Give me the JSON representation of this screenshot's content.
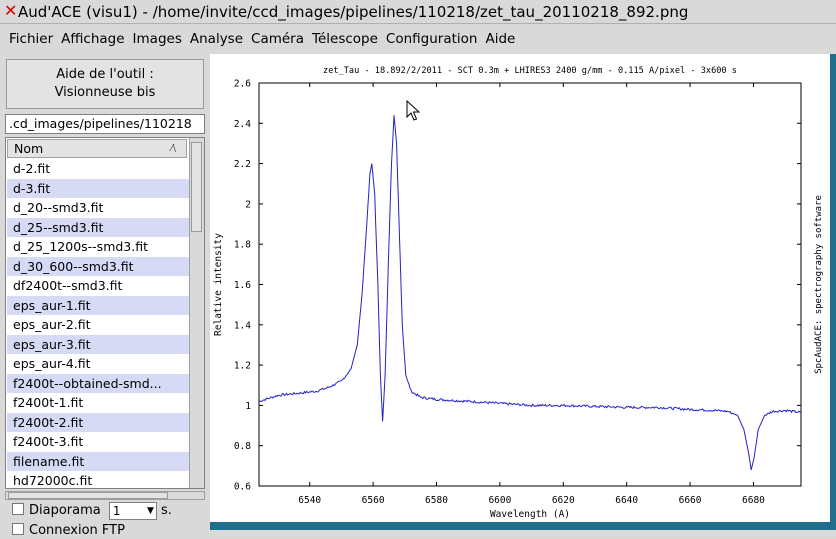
{
  "window": {
    "title": "Aud'ACE (visu1) - /home/invite/ccd_images/pipelines/110218/zet_tau_20110218_892.png"
  },
  "menu": [
    "Fichier",
    "Affichage",
    "Images",
    "Analyse",
    "Caméra",
    "Télescope",
    "Configuration",
    "Aide"
  ],
  "sidebar": {
    "help_line1": "Aide de l'outil :",
    "help_line2": "Visionneuse bis",
    "path": ".cd_images/pipelines/110218",
    "column_header": "Nom",
    "files": [
      "d-2.fit",
      "d-3.fit",
      "d_20--smd3.fit",
      "d_25--smd3.fit",
      "d_25_1200s--smd3.fit",
      "d_30_600--smd3.fit",
      "df2400t--smd3.fit",
      "eps_aur-1.fit",
      "eps_aur-2.fit",
      "eps_aur-3.fit",
      "eps_aur-4.fit",
      "f2400t--obtained-smd...",
      "f2400t-1.fit",
      "f2400t-2.fit",
      "f2400t-3.fit",
      "filename.fit",
      "hd72000c.fit"
    ],
    "diaporama_label": "Diaporama",
    "diaporama_value": "1",
    "diaporama_unit": "s.",
    "ftp_label": "Connexion FTP"
  },
  "colors": {
    "spectrum": "#2222cc",
    "accent": "#1f6f8b"
  },
  "chart_data": {
    "type": "line",
    "title": "zet_Tau - 18.892/2/2011 - SCT 0.3m + LHIRES3 2400 g/mm - 0.115 A/pixel - 3x600 s",
    "xlabel": "Wavelength (A)",
    "ylabel": "Relative intensity",
    "right_label": "SpcAudACE: spectrography software",
    "xlim": [
      6524,
      6695
    ],
    "ylim": [
      0.6,
      2.6
    ],
    "xticks": [
      6540,
      6560,
      6580,
      6600,
      6620,
      6640,
      6660,
      6680
    ],
    "yticks": [
      0.6,
      0.8,
      1,
      1.2,
      1.4,
      1.6,
      1.8,
      2,
      2.2,
      2.4,
      2.6
    ],
    "grid": false,
    "series": [
      {
        "x": [
          6524,
          6530,
          6536,
          6542,
          6546,
          6550,
          6553,
          6555,
          6556.5,
          6558,
          6559,
          6559.6,
          6560.5,
          6561.5,
          6562.3,
          6563,
          6563.8,
          6564.8,
          6565.8,
          6566.6,
          6567.4,
          6568.3,
          6569.2,
          6570.3,
          6572,
          6575,
          6580,
          6590,
          6600,
          6610,
          6620,
          6630,
          6640,
          6650,
          6660,
          6668,
          6672,
          6675,
          6677,
          6678.5,
          6679.3,
          6680.2,
          6681.5,
          6683.5,
          6686,
          6690,
          6695
        ],
        "y": [
          1.02,
          1.05,
          1.06,
          1.07,
          1.09,
          1.12,
          1.18,
          1.3,
          1.55,
          1.9,
          2.15,
          2.2,
          2.05,
          1.6,
          1.15,
          0.92,
          1.15,
          1.7,
          2.2,
          2.44,
          2.3,
          1.85,
          1.4,
          1.15,
          1.07,
          1.04,
          1.03,
          1.02,
          1.01,
          1.0,
          1.0,
          0.995,
          0.99,
          0.99,
          0.98,
          0.975,
          0.97,
          0.95,
          0.88,
          0.76,
          0.68,
          0.74,
          0.88,
          0.95,
          0.97,
          0.975,
          0.965
        ]
      }
    ]
  }
}
